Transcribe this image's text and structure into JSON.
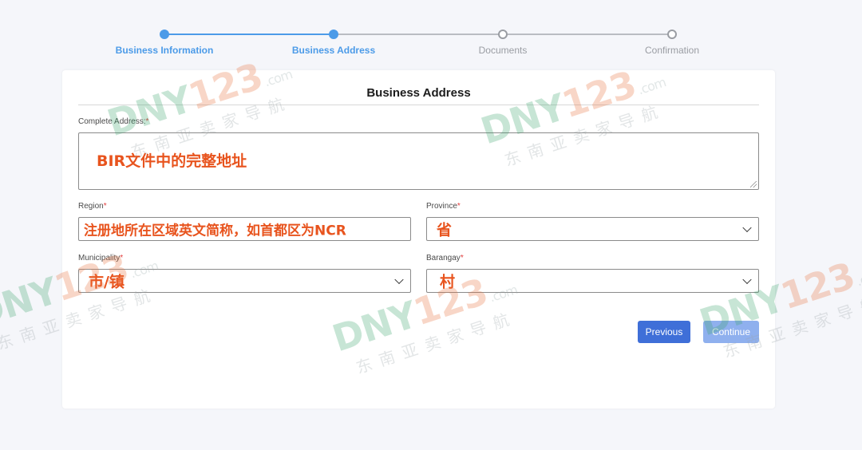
{
  "stepper": {
    "steps": [
      {
        "label": "Business Information",
        "state": "done"
      },
      {
        "label": "Business Address",
        "state": "done"
      },
      {
        "label": "Documents",
        "state": "todo"
      },
      {
        "label": "Confirmation",
        "state": "todo"
      }
    ]
  },
  "form": {
    "title": "Business Address",
    "required_mark": "*",
    "complete_address": {
      "label": "Complete Address:",
      "value": "BIR文件中的完整地址"
    },
    "region": {
      "label": "Region",
      "value": "注册地所在区域英文简称，如首都区为NCR"
    },
    "province": {
      "label": "Province",
      "value": "省"
    },
    "municipality": {
      "label": "Municipality",
      "value": "市/镇"
    },
    "barangay": {
      "label": "Barangay",
      "value": "村"
    }
  },
  "buttons": {
    "previous": "Previous",
    "continue": "Continue"
  },
  "watermark": {
    "brand_green": "DNY",
    "brand_orange": "123",
    "suffix": ".com",
    "tagline": "东南亚卖家导航"
  },
  "colors": {
    "accent": "#4c9be8",
    "primary_button": "#3f6fd8",
    "disabled_button": "#8fb0ee",
    "annotation": "#e8541e",
    "required": "#e23b3b"
  }
}
